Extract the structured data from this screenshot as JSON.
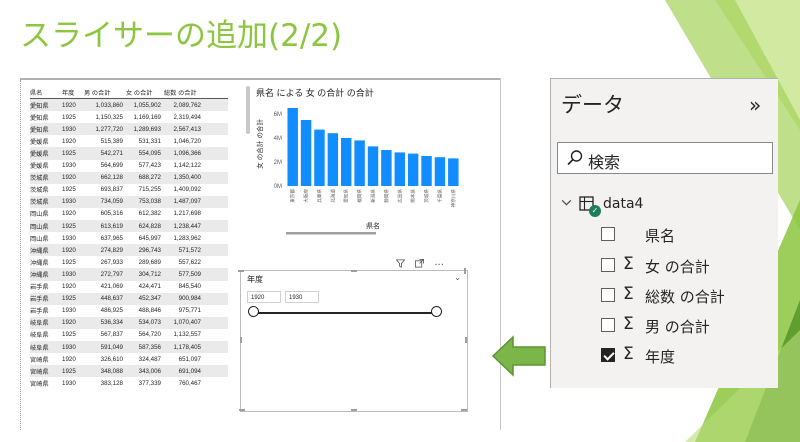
{
  "slide": {
    "title": "スライサーの追加(2/2)"
  },
  "table": {
    "headers": [
      "県名",
      "年度",
      "男 の合計",
      "女 の合計",
      "総数 の合計"
    ],
    "rows": [
      [
        "愛知県",
        "1920",
        "1,033,860",
        "1,055,902",
        "2,089,762"
      ],
      [
        "愛知県",
        "1925",
        "1,150,325",
        "1,169,169",
        "2,319,494"
      ],
      [
        "愛知県",
        "1930",
        "1,277,720",
        "1,289,693",
        "2,567,413"
      ],
      [
        "愛媛県",
        "1920",
        "515,389",
        "531,331",
        "1,046,720"
      ],
      [
        "愛媛県",
        "1925",
        "542,271",
        "554,095",
        "1,096,366"
      ],
      [
        "愛媛県",
        "1930",
        "564,699",
        "577,423",
        "1,142,122"
      ],
      [
        "茨城県",
        "1920",
        "662,128",
        "688,272",
        "1,350,400"
      ],
      [
        "茨城県",
        "1925",
        "693,837",
        "715,255",
        "1,409,092"
      ],
      [
        "茨城県",
        "1930",
        "734,059",
        "753,038",
        "1,487,097"
      ],
      [
        "岡山県",
        "1920",
        "605,316",
        "612,382",
        "1,217,698"
      ],
      [
        "岡山県",
        "1925",
        "613,619",
        "624,828",
        "1,238,447"
      ],
      [
        "岡山県",
        "1930",
        "637,965",
        "645,997",
        "1,283,962"
      ],
      [
        "沖縄県",
        "1920",
        "274,829",
        "296,743",
        "571,572"
      ],
      [
        "沖縄県",
        "1925",
        "267,933",
        "289,689",
        "557,622"
      ],
      [
        "沖縄県",
        "1930",
        "272,797",
        "304,712",
        "577,509"
      ],
      [
        "岩手県",
        "1920",
        "421,069",
        "424,471",
        "845,540"
      ],
      [
        "岩手県",
        "1925",
        "448,637",
        "452,347",
        "900,984"
      ],
      [
        "岩手県",
        "1930",
        "486,925",
        "488,846",
        "975,771"
      ],
      [
        "岐阜県",
        "1920",
        "536,334",
        "534,073",
        "1,070,407"
      ],
      [
        "岐阜県",
        "1925",
        "567,837",
        "564,720",
        "1,132,557"
      ],
      [
        "岐阜県",
        "1930",
        "591,049",
        "587,356",
        "1,178,405"
      ],
      [
        "宮崎県",
        "1920",
        "326,610",
        "324,487",
        "651,097"
      ],
      [
        "宮崎県",
        "1925",
        "348,088",
        "343,006",
        "691,094"
      ],
      [
        "宮崎県",
        "1930",
        "383,128",
        "377,339",
        "760,467"
      ]
    ]
  },
  "chart_data": {
    "type": "bar",
    "title": "県名 による 女 の合計 の合計",
    "xlabel": "県名",
    "ylabel": "女 の合計 の合計",
    "y_ticks": [
      "0M",
      "2M",
      "4M",
      "6M"
    ],
    "ylim": [
      0,
      7
    ],
    "categories": [
      "東京都",
      "大阪府",
      "兵庫県",
      "北海道",
      "愛知県",
      "福岡県",
      "新潟県",
      "静岡県",
      "広島県",
      "熊本県",
      "茨城県",
      "千葉県",
      "神奈川県"
    ],
    "values": [
      6.5,
      5.5,
      4.7,
      4.4,
      4.0,
      3.8,
      3.3,
      3.0,
      2.8,
      2.7,
      2.5,
      2.4,
      2.3
    ],
    "color": "#118dff"
  },
  "slicer": {
    "title": "年度",
    "chevron": "⌄",
    "from": "1920",
    "to": "1930",
    "tools": [
      "filter-icon",
      "focus-mode-icon",
      "more-options-icon"
    ],
    "more_label": "···"
  },
  "pane": {
    "title": "データ",
    "collapse_glyph": "»",
    "search_label": "検索",
    "table_name": "data4",
    "fields": [
      {
        "label": "県名",
        "sigma": false,
        "checked": false
      },
      {
        "label": "女 の合計",
        "sigma": true,
        "checked": false
      },
      {
        "label": "総数 の合計",
        "sigma": true,
        "checked": false
      },
      {
        "label": "男 の合計",
        "sigma": true,
        "checked": false
      },
      {
        "label": "年度",
        "sigma": true,
        "checked": true
      }
    ]
  },
  "colors": {
    "title_green": "#8cc63f",
    "arrow_green": "#7ab648",
    "bar_blue": "#118dff"
  }
}
